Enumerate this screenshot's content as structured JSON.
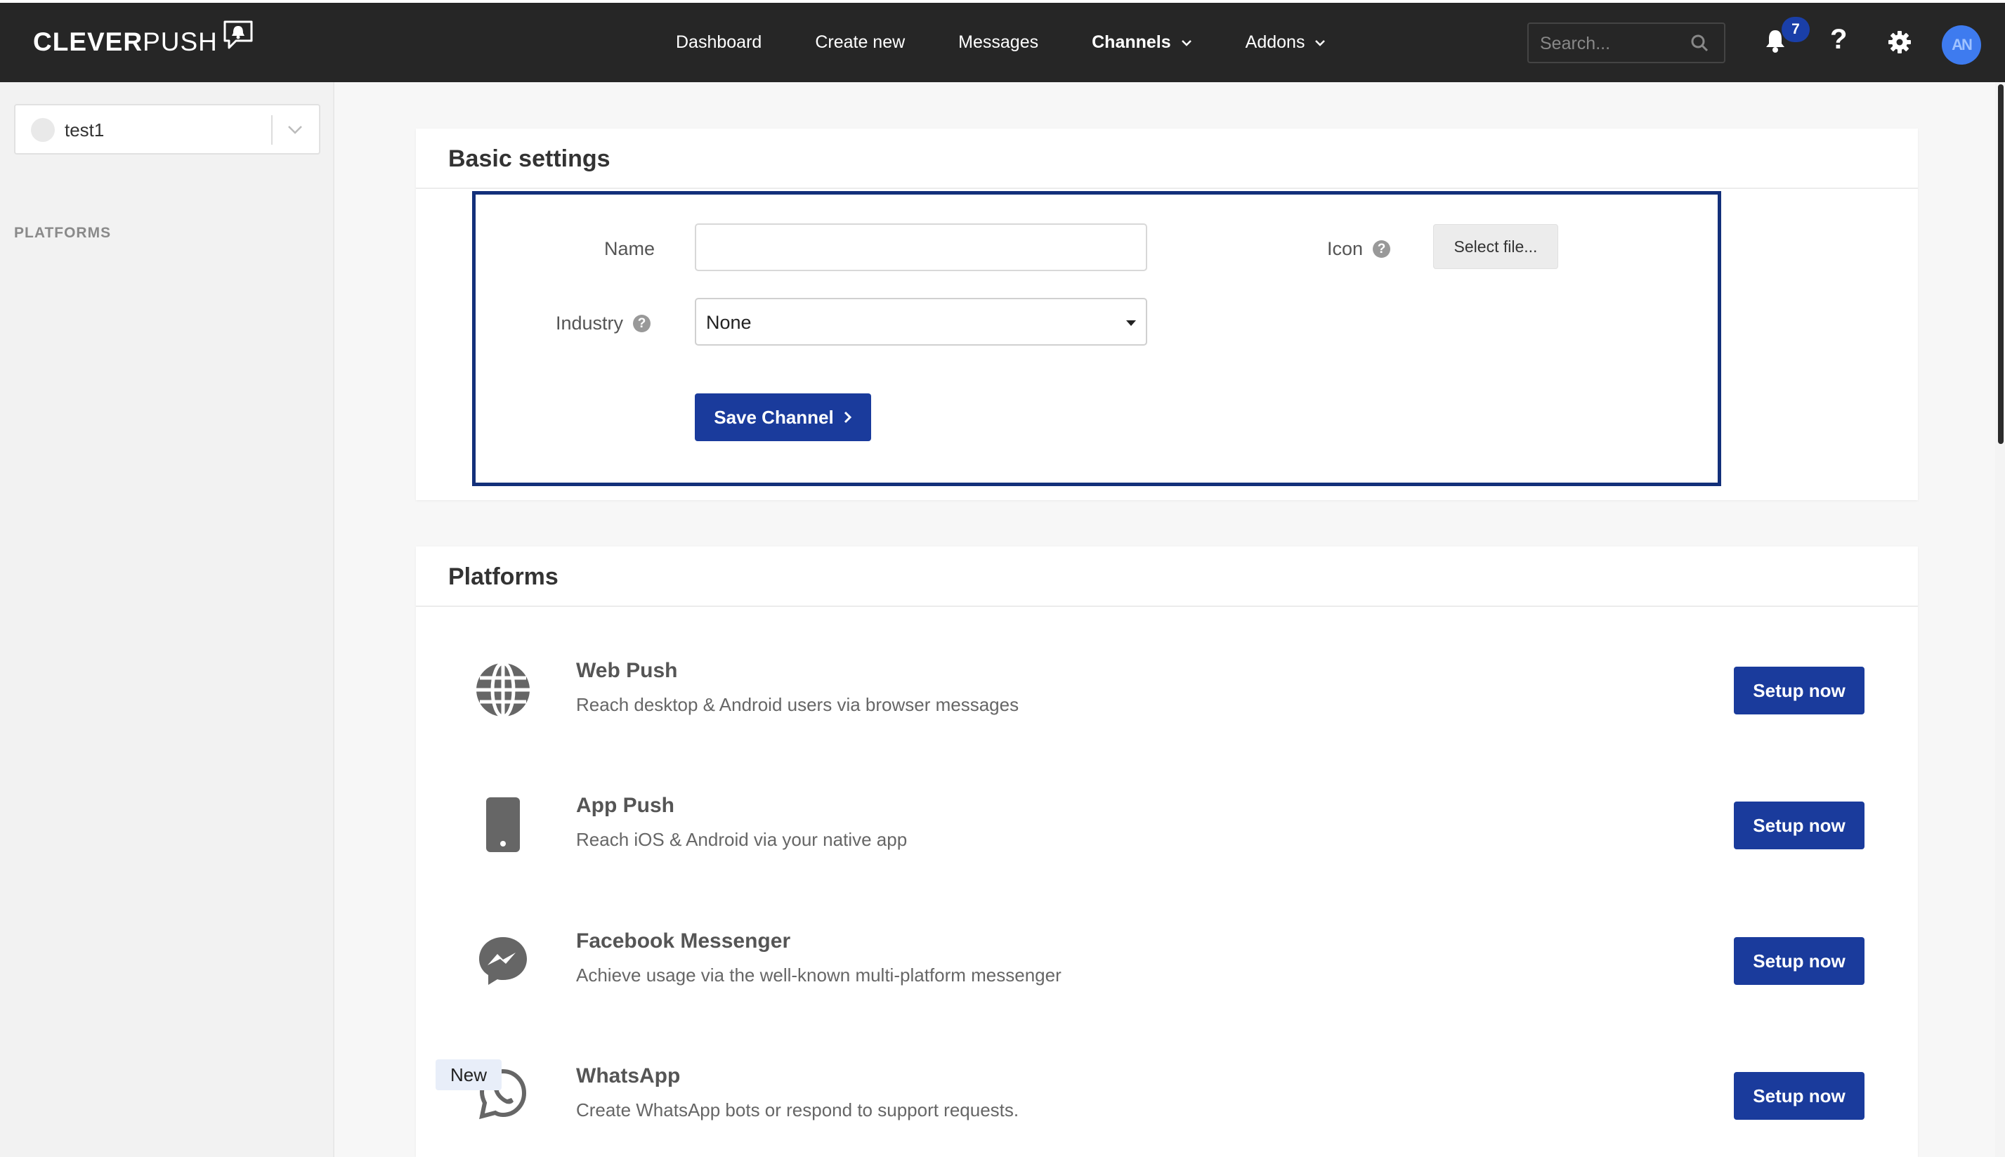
{
  "brand": {
    "logo_text_bold": "CLEVER",
    "logo_text_light": "PUSH"
  },
  "nav": {
    "items": [
      {
        "label": "Dashboard"
      },
      {
        "label": "Create new"
      },
      {
        "label": "Messages"
      },
      {
        "label": "Channels"
      },
      {
        "label": "Addons"
      }
    ],
    "search_placeholder": "Search...",
    "notification_count": "7",
    "help_symbol": "?",
    "avatar_initials": "AN"
  },
  "sidebar": {
    "channel_name": "test1",
    "section_label": "PLATFORMS"
  },
  "basic_settings": {
    "title": "Basic settings",
    "name_label": "Name",
    "name_value": "",
    "industry_label": "Industry",
    "industry_value": "None",
    "icon_label": "Icon",
    "select_file_label": "Select file...",
    "save_label": "Save Channel"
  },
  "platforms": {
    "title": "Platforms",
    "items": [
      {
        "title": "Web Push",
        "description": "Reach desktop & Android users via browser messages",
        "button": "Setup now",
        "icon": "globe-icon"
      },
      {
        "title": "App Push",
        "description": "Reach iOS & Android via your native app",
        "button": "Setup now",
        "icon": "mobile-phone-icon"
      },
      {
        "title": "Facebook Messenger",
        "description": "Achieve usage via the well-known multi-platform messenger",
        "button": "Setup now",
        "icon": "messenger-icon"
      },
      {
        "title": "WhatsApp",
        "description": "Create WhatsApp bots or respond to support requests.",
        "button": "Setup now",
        "icon": "whatsapp-icon",
        "badge": "New"
      }
    ]
  },
  "colors": {
    "navbar": "#262626",
    "primary_button": "#1a3b9c",
    "highlight_border": "#13307a",
    "badge": "#1a3fa8"
  }
}
